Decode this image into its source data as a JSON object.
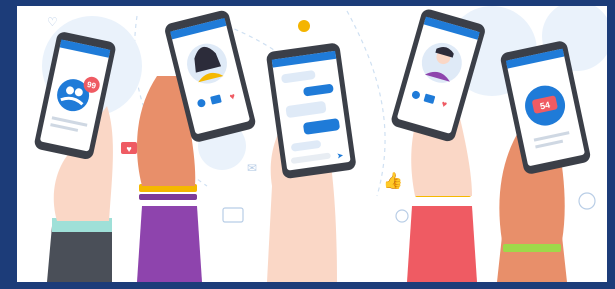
{
  "illustration": {
    "phone_1": {
      "badge_count": "99",
      "accent": "#1f7bd8"
    },
    "phone_2": {
      "avatar": "woman-avatar"
    },
    "phone_3": {
      "type": "chat-screen"
    },
    "phone_4": {
      "avatar": "man-avatar"
    },
    "phone_5": {
      "badge_count": "54",
      "accent": "#1f7bd8"
    },
    "colors": {
      "frame": "#1c3c79",
      "accent_blue": "#1f7bd8",
      "badge_red": "#ef5b63",
      "phone_body": "#3b3f48",
      "skin_light": "#fad7c6",
      "skin_tan": "#e88f6a"
    }
  }
}
